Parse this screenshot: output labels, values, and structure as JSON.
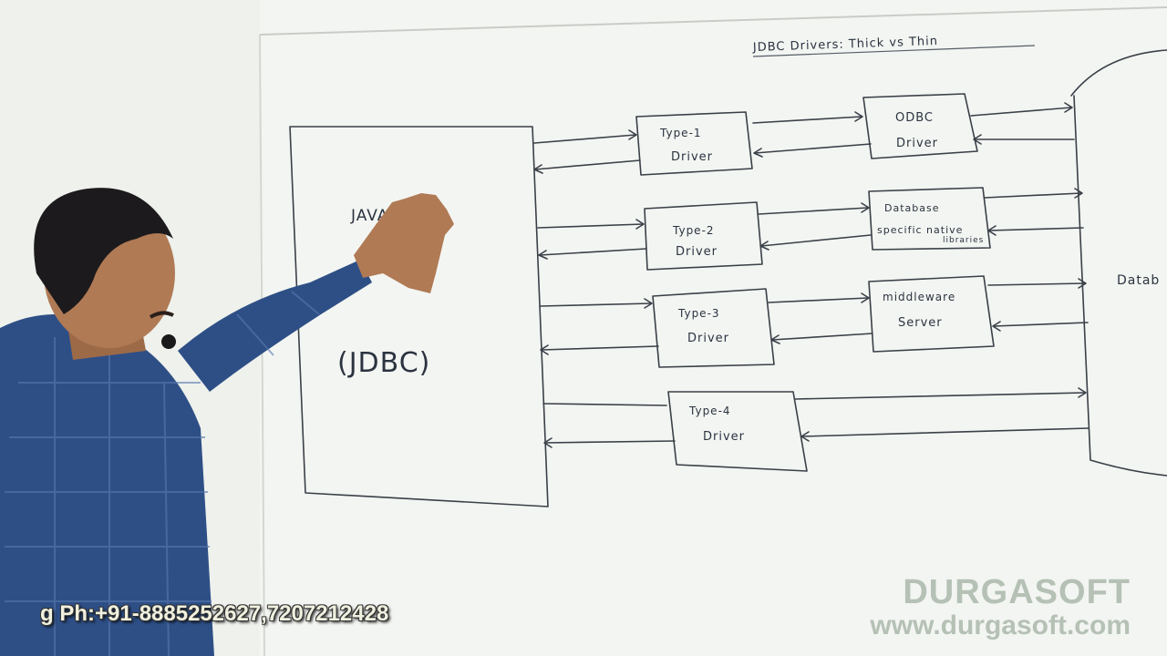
{
  "board": {
    "title": "JDBC Drivers: Thick vs Thin",
    "app_box": {
      "line1": "JAVA",
      "line2": "(JDBC)"
    },
    "drivers": [
      {
        "label_top": "Type-1",
        "label_bottom": "Driver"
      },
      {
        "label_top": "Type-2",
        "label_bottom": "Driver"
      },
      {
        "label_top": "Type-3",
        "label_bottom": "Driver"
      },
      {
        "label_top": "Type-4",
        "label_bottom": "Driver"
      }
    ],
    "middle": [
      {
        "line1": "ODBC",
        "line2": "Driver",
        "line3": ""
      },
      {
        "line1": "Database",
        "line2": "specific native",
        "line3": "libraries"
      },
      {
        "line1": "middleware",
        "line2": "Server",
        "line3": ""
      }
    ],
    "database_label": "Datab"
  },
  "overlay": {
    "phone": "g Ph:+91-8885252627,7207212428",
    "brand_name": "DURGASOFT",
    "brand_url": "www.durgasoft.com"
  },
  "colors": {
    "board": "#f3f5f2",
    "ink": "#3a4048",
    "shirt": "#2e4f86",
    "skin": "#b07a55",
    "hair": "#1c1a1c"
  }
}
